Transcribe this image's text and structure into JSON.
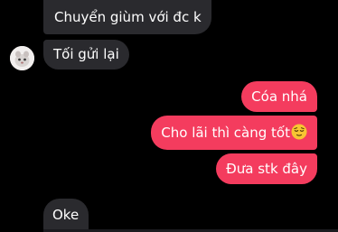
{
  "conversation": {
    "messages": [
      {
        "sender": "contact",
        "text": "Chuyển giùm với đc k"
      },
      {
        "sender": "contact",
        "text": "Tối gửi lại"
      },
      {
        "sender": "me",
        "text": "Cóa nhá"
      },
      {
        "sender": "me",
        "text": "Cho lãi thì càng tốt",
        "emoji": "relieved-face-icon"
      },
      {
        "sender": "me",
        "text": "Đưa stk đây"
      },
      {
        "sender": "contact",
        "text": "Oke"
      }
    ]
  },
  "colors": {
    "background": "#000000",
    "incoming_bubble": "#2a2a2e",
    "outgoing_bubble": "#f43c5e",
    "text": "#ffffff"
  }
}
